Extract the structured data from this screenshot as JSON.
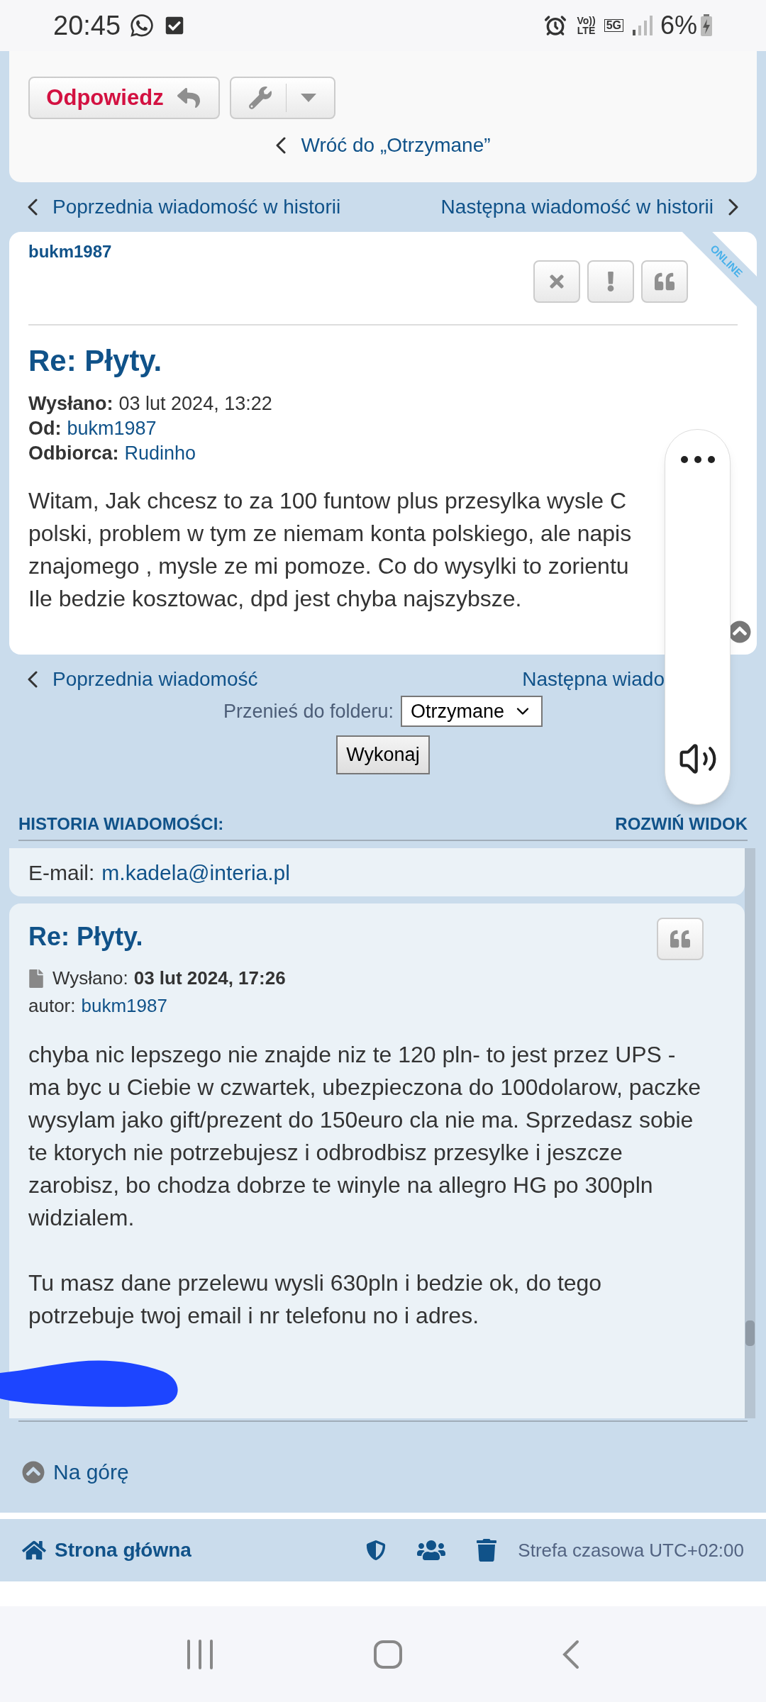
{
  "status_bar": {
    "time": "20:45",
    "volte": [
      "Vo))",
      "LTE"
    ],
    "network": "5G",
    "battery": "6%"
  },
  "top_actions": {
    "reply_button": "Odpowiedz",
    "back_link": "Wróć do „Otrzymane”"
  },
  "history_nav": {
    "previous": "Poprzednia wiadomość w historii",
    "next": "Następna wiadomość w historii"
  },
  "message": {
    "author": "bukm1987",
    "online_badge": "ONLINE",
    "title": "Re: Płyty.",
    "meta": [
      {
        "label": "Wysłano:",
        "value": "03 lut 2024, 13:22",
        "kind": "text"
      },
      {
        "label": "Od:",
        "value": "bukm1987",
        "kind": "link"
      },
      {
        "label": "Odbiorca:",
        "value": "Rudinho",
        "kind": "link"
      }
    ],
    "body_lines": [
      "Witam, Jak chcesz to za 100 funtow plus przesylka wysle C",
      "polski, problem w tym ze niemam konta polskiego, ale napis",
      "znajomego , mysle ze mi pomoze. Co do wysylki to zorientu",
      "Ile bedzie kosztowac, dpd jest chyba najszybsze."
    ]
  },
  "message_nav": {
    "previous": "Poprzednia wiadomość",
    "next": "Następna wiado"
  },
  "move_folder": {
    "label": "Przenieś do folderu:",
    "value": "Otrzymane",
    "button": "Wykonaj"
  },
  "history": {
    "header": "HISTORIA WIADOMOŚCI:",
    "expand_link": "ROZWIŃ WIDOK",
    "email_label": "E-mail:",
    "email": "m.kadela@interia.pl",
    "post": {
      "title": "Re: Płyty.",
      "sent_label": "Wysłano:",
      "sent": "03 lut 2024, 17:26",
      "author_label": "autor:",
      "author": "bukm1987",
      "paragraphs": [
        "chyba nic lepszego nie znajde niz te 120 pln- to jest przez UPS - ma byc u Ciebie w czwartek, ubezpieczona do 100dolarow, paczke wysylam jako gift/prezent do 150euro cla nie ma. Sprzedasz sobie te ktorych nie potrzebujesz i odbrodbisz przesylke i jeszcze zarobisz, bo chodza dobrze te winyle na allegro HG po 300pln widzialem.",
        "Tu masz dane przelewu wysli 630pln i bedzie ok, do tego potrzebuje twoj email i nr telefonu no i adres."
      ]
    }
  },
  "back_to_top": "Na górę",
  "footer": {
    "home": "Strona główna",
    "timezone": "Strefa czasowa UTC+02:00"
  }
}
